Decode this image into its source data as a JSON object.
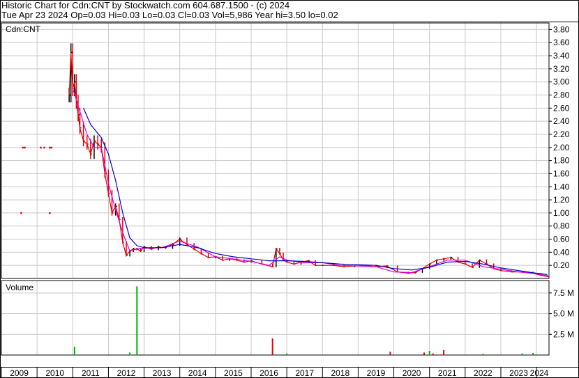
{
  "header": {
    "line1": "Historic Chart for Cdn:CNT by Stockwatch.com 604.687.1500 - (c) 2024",
    "line2": "Tue Apr 23 2024  Op=0.03  Hi=0.03  Lo=0.03  Cl=0.03  Vol=5,986  Year hi=3.50  lo=0.02"
  },
  "colors": {
    "background": "#ffffff",
    "grid": "#c8c8c8",
    "frame": "#000000",
    "up_bar": "#000000",
    "down_bar": "#e00000",
    "ma_short": "#e000e0",
    "ma_long": "#0000c8",
    "volume_up": "#00b000",
    "volume_down": "#e00000"
  },
  "chart_data": [
    {
      "type": "line",
      "title": "Cdn:CNT",
      "ylabel": "",
      "xlabel": "",
      "ylim": [
        0,
        3.9
      ],
      "xlim": [
        2009.0,
        2024.35
      ],
      "y_ticks": [
        "3.80",
        "3.60",
        "3.40",
        "3.20",
        "3.00",
        "2.80",
        "2.60",
        "2.40",
        "2.20",
        "2.00",
        "1.80",
        "1.60",
        "1.40",
        "1.20",
        "1.00",
        "0.80",
        "0.60",
        "0.40",
        "0.20"
      ],
      "x_ticks": [
        "2009",
        "2010",
        "2011",
        "2012",
        "2013",
        "2014",
        "2015",
        "2016",
        "2017",
        "2018",
        "2019",
        "2020",
        "2021",
        "2022",
        "2023",
        "2024"
      ],
      "grid": true,
      "series": [
        {
          "role": "price",
          "x": [
            2010.9,
            2010.95,
            2011.0,
            2011.05,
            2011.1,
            2011.15,
            2011.2,
            2011.3,
            2011.4,
            2011.5,
            2011.6,
            2011.7,
            2011.8,
            2011.9,
            2012.0,
            2012.1,
            2012.2,
            2012.3,
            2012.4,
            2012.5,
            2012.6,
            2012.7,
            2012.8,
            2012.9,
            2013.0,
            2013.2,
            2013.4,
            2013.6,
            2013.8,
            2014.0,
            2014.2,
            2014.4,
            2014.6,
            2014.8,
            2015.0,
            2015.2,
            2015.4,
            2015.6,
            2015.8,
            2016.0,
            2016.3,
            2016.6,
            2016.7,
            2016.8,
            2016.9,
            2017.0,
            2017.2,
            2017.4,
            2017.6,
            2017.8,
            2018.0,
            2018.3,
            2018.6,
            2018.9,
            2019.2,
            2019.5,
            2019.8,
            2020.1,
            2020.4,
            2020.6,
            2020.8,
            2021.0,
            2021.2,
            2021.4,
            2021.6,
            2021.8,
            2022.0,
            2022.2,
            2022.4,
            2022.6,
            2022.8,
            2023.0,
            2023.3,
            2023.6,
            2023.9,
            2024.1,
            2024.3
          ],
          "y": [
            2.8,
            3.45,
            2.9,
            3.0,
            2.7,
            2.5,
            2.3,
            2.1,
            2.05,
            1.9,
            2.1,
            2.05,
            2.0,
            1.6,
            1.3,
            1.0,
            1.1,
            0.9,
            0.55,
            0.35,
            0.42,
            0.45,
            0.45,
            0.42,
            0.48,
            0.45,
            0.48,
            0.47,
            0.52,
            0.6,
            0.52,
            0.45,
            0.38,
            0.32,
            0.33,
            0.28,
            0.3,
            0.28,
            0.25,
            0.27,
            0.22,
            0.18,
            0.45,
            0.38,
            0.28,
            0.25,
            0.22,
            0.25,
            0.27,
            0.2,
            0.2,
            0.2,
            0.18,
            0.19,
            0.2,
            0.18,
            0.19,
            0.1,
            0.08,
            0.09,
            0.15,
            0.22,
            0.28,
            0.3,
            0.32,
            0.25,
            0.22,
            0.17,
            0.28,
            0.22,
            0.15,
            0.12,
            0.1,
            0.1,
            0.08,
            0.05,
            0.03
          ]
        },
        {
          "role": "ma_short",
          "x": [
            2011.0,
            2011.2,
            2011.4,
            2011.6,
            2011.8,
            2012.0,
            2012.2,
            2012.4,
            2012.6,
            2012.8,
            2013.0,
            2013.5,
            2014.0,
            2014.5,
            2015.0,
            2015.5,
            2016.0,
            2016.5,
            2016.8,
            2017.0,
            2017.5,
            2018.0,
            2018.5,
            2019.0,
            2019.5,
            2020.0,
            2020.5,
            2021.0,
            2021.5,
            2022.0,
            2022.5,
            2023.0,
            2023.5,
            2024.0,
            2024.3
          ],
          "y": [
            2.9,
            2.55,
            2.2,
            2.0,
            2.0,
            1.45,
            1.05,
            0.7,
            0.42,
            0.45,
            0.46,
            0.47,
            0.57,
            0.48,
            0.33,
            0.3,
            0.26,
            0.2,
            0.33,
            0.28,
            0.24,
            0.24,
            0.2,
            0.19,
            0.18,
            0.1,
            0.09,
            0.18,
            0.28,
            0.28,
            0.18,
            0.14,
            0.1,
            0.07,
            0.04
          ]
        },
        {
          "role": "ma_long",
          "x": [
            2011.3,
            2011.5,
            2011.8,
            2012.0,
            2012.2,
            2012.4,
            2012.6,
            2012.8,
            2013.0,
            2013.5,
            2014.0,
            2014.5,
            2015.0,
            2015.5,
            2016.0,
            2016.5,
            2017.0,
            2017.5,
            2018.0,
            2018.5,
            2019.0,
            2019.5,
            2020.0,
            2020.5,
            2021.0,
            2021.5,
            2022.0,
            2022.5,
            2023.0,
            2023.5,
            2024.0,
            2024.3
          ],
          "y": [
            2.6,
            2.35,
            2.15,
            1.9,
            1.5,
            1.0,
            0.62,
            0.5,
            0.47,
            0.47,
            0.52,
            0.47,
            0.38,
            0.33,
            0.3,
            0.27,
            0.27,
            0.26,
            0.24,
            0.22,
            0.21,
            0.2,
            0.15,
            0.13,
            0.17,
            0.25,
            0.26,
            0.22,
            0.16,
            0.12,
            0.08,
            0.06
          ]
        },
        {
          "role": "early_points",
          "x": [
            2009.6,
            2009.65,
            2010.1,
            2010.2,
            2010.35,
            2010.4,
            2009.55,
            2010.35
          ],
          "y": [
            2.0,
            2.0,
            2.0,
            2.0,
            2.0,
            2.0,
            1.0,
            1.0
          ]
        }
      ]
    },
    {
      "type": "bar",
      "title": "Volume",
      "ylim": [
        0,
        9.0
      ],
      "y_ticks": [
        "7.5 M",
        "5.0 M",
        "2.5 M"
      ],
      "y_tick_values": [
        7.5,
        5.0,
        2.5
      ],
      "x": [
        2011.05,
        2012.6,
        2012.8,
        2016.6,
        2017.0,
        2019.9,
        2020.85,
        2021.0,
        2021.1,
        2021.4,
        2022.5,
        2023.6,
        2023.9
      ],
      "values": [
        1.0,
        0.3,
        8.3,
        2.0,
        0.2,
        0.4,
        0.3,
        0.5,
        0.2,
        0.6,
        0.15,
        0.2,
        0.25
      ],
      "direction": [
        "up",
        "up",
        "up",
        "down",
        "up",
        "down",
        "down",
        "up",
        "down",
        "down",
        "up",
        "up",
        "up"
      ]
    }
  ]
}
